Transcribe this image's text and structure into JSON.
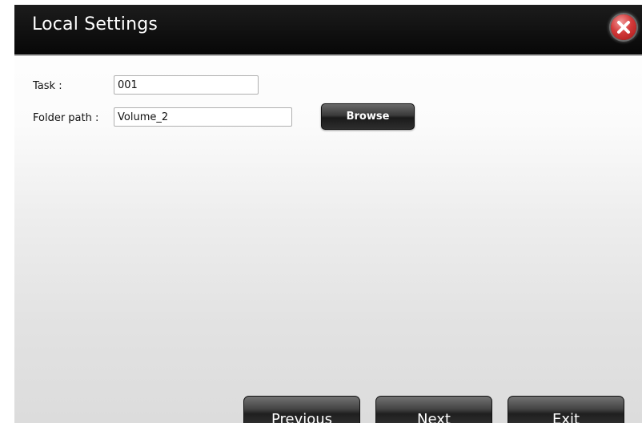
{
  "dialog": {
    "title": "Local Settings"
  },
  "form": {
    "task_label": "Task :",
    "task_value": "001",
    "folder_label": "Folder path :",
    "folder_value": "Volume_2",
    "browse_label": "Browse"
  },
  "footer": {
    "previous_label": "Previous",
    "next_label": "Next",
    "exit_label": "Exit"
  },
  "icons": {
    "close": "close-icon"
  },
  "colors": {
    "titlebar": "#0a0a0a",
    "close_button": "#d23a3a",
    "button": "#2a2a2a"
  }
}
